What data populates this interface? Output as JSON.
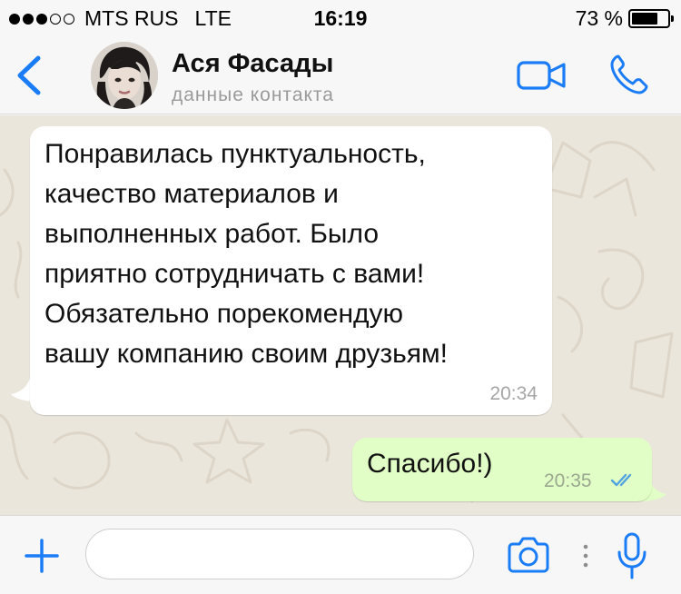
{
  "status_bar": {
    "carrier": "MTS RUS",
    "network": "LTE",
    "time": "16:19",
    "battery_percent": "73 %",
    "battery_level": 0.73,
    "signal_bars_filled": 3,
    "signal_bars_total": 5
  },
  "header": {
    "back_icon": "chevron-left-icon",
    "contact_name": "Ася Фасады",
    "contact_subtitle": "данные контакта",
    "video_icon": "video-camera-icon",
    "call_icon": "phone-icon"
  },
  "messages": [
    {
      "direction": "incoming",
      "text": "Понравилась пунктуальность,\nкачество материалов и\nвыполненных работ. Было\nприятно сотрудничать с вами!\nОбязательно порекомендую\nвашу компанию своим друзьям!",
      "time": "20:34"
    },
    {
      "direction": "outgoing",
      "text": "Спасибо!)",
      "time": "20:35",
      "status": "read"
    }
  ],
  "input_bar": {
    "attach_icon": "plus-icon",
    "message_value": "",
    "camera_icon": "camera-icon",
    "more_icon": "more-vertical-icon",
    "mic_icon": "microphone-icon"
  },
  "colors": {
    "accent": "#1a7cf6",
    "incoming_bubble": "#ffffff",
    "outgoing_bubble": "#e1fec6",
    "chat_background": "#ebe6dc",
    "read_ticks": "#4fa3e0"
  }
}
